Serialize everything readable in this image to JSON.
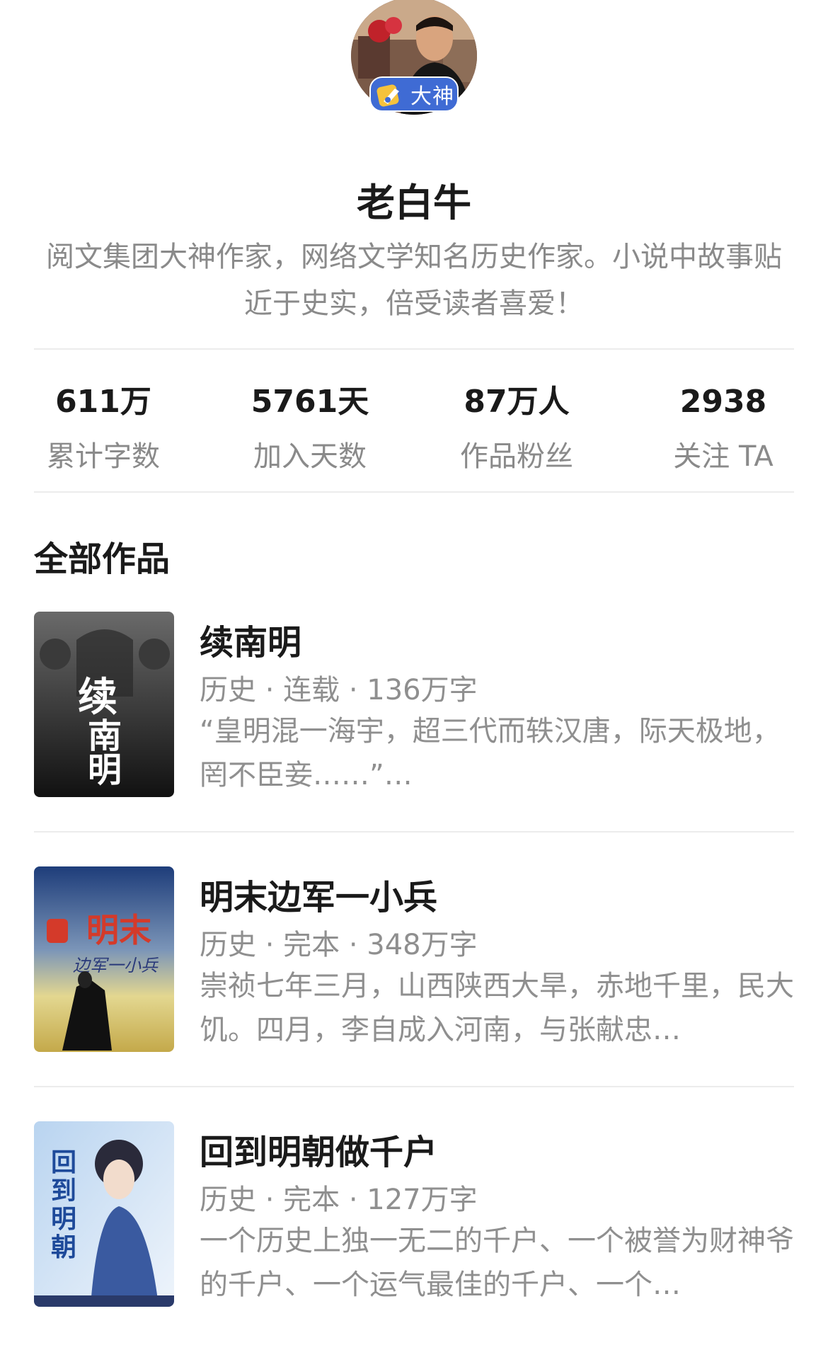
{
  "author": {
    "badge_label": "大神",
    "name": "老白牛",
    "bio": "阅文集团大神作家，网络文学知名历史作家。小说中故事贴近于史实，倍受读者喜爱！"
  },
  "stats": [
    {
      "value": "611万",
      "label": "累计字数"
    },
    {
      "value": "5761天",
      "label": "加入天数"
    },
    {
      "value": "87万人",
      "label": "作品粉丝"
    },
    {
      "value": "2938",
      "label": "关注 TA"
    }
  ],
  "section_title": "全部作品",
  "books": [
    {
      "title": "续南明",
      "meta": "历史 · 连载 · 136万字",
      "desc": "“皇明混一海宇，超三代而轶汉唐，际天极地，罔不臣妾……”…",
      "cover_text": "续南明"
    },
    {
      "title": "明末边军一小兵",
      "meta": "历史 · 完本 · 348万字",
      "desc": "崇祯七年三月，山西陕西大旱，赤地千里，民大饥。四月，李自成入河南，与张献忠…",
      "cover_text": "明末"
    },
    {
      "title": "回到明朝做千户",
      "meta": "历史 · 完本 · 127万字",
      "desc": "一个历史上独一无二的千户、一个被誉为财神爷的千户、一个运气最佳的千户、一个…",
      "cover_text": "回到明朝"
    }
  ],
  "colors": {
    "badge": "#3f6bd4",
    "primary_text": "#1a1a1a",
    "secondary_text": "#8a8a8a",
    "divider": "#ececec"
  }
}
